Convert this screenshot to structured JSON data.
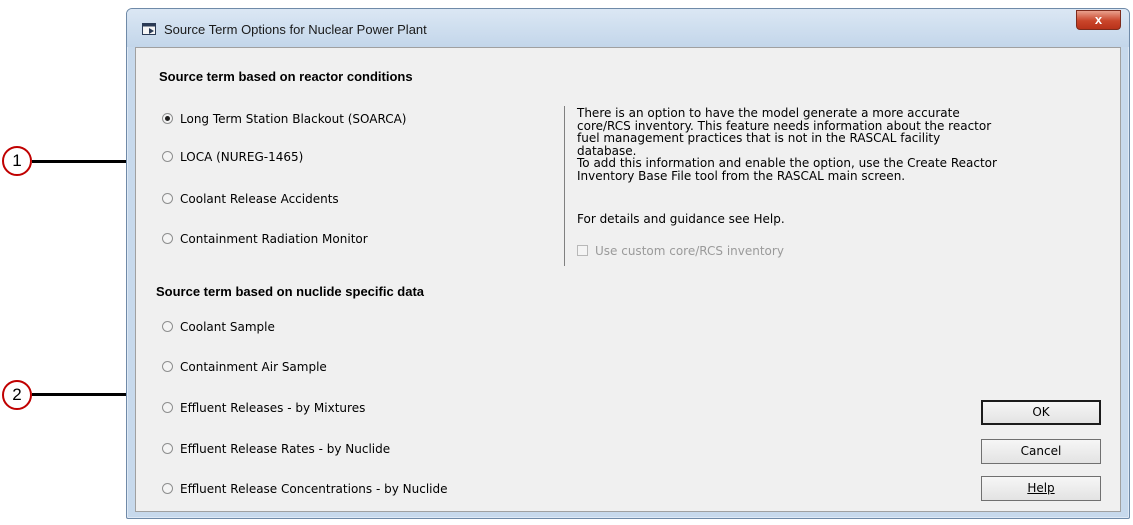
{
  "window": {
    "title": "Source Term Options for Nuclear Power Plant",
    "close_label": "x"
  },
  "annotations": [
    {
      "label": "1"
    },
    {
      "label": "2"
    }
  ],
  "reactor_section": {
    "heading": "Source term based on reactor conditions",
    "options": [
      {
        "label": "Long Term Station Blackout (SOARCA)",
        "checked": true
      },
      {
        "label": "LOCA (NUREG-1465)",
        "checked": false
      },
      {
        "label": "Coolant Release Accidents",
        "checked": false
      },
      {
        "label": "Containment Radiation Monitor",
        "checked": false
      }
    ]
  },
  "info_panel": {
    "lines": [
      "There is an option to have the model generate a more accurate",
      "core/RCS inventory. This feature needs information about the reactor",
      "fuel management practices that is not in the RASCAL facility database.",
      "To add this information and enable the option, use the Create Reactor",
      "Inventory Base File tool from the RASCAL main screen."
    ],
    "help_hint": "For details and guidance see Help.",
    "custom_inventory_label": "Use custom core/RCS inventory",
    "custom_inventory_checked": false,
    "custom_inventory_enabled": false
  },
  "nuclide_section": {
    "heading": "Source term based on nuclide specific data",
    "options": [
      {
        "label": "Coolant Sample",
        "checked": false
      },
      {
        "label": "Containment Air Sample",
        "checked": false
      },
      {
        "label": "Effluent Releases - by Mixtures",
        "checked": false
      },
      {
        "label": "Effluent Release Rates - by Nuclide",
        "checked": false
      },
      {
        "label": "Effluent Release Concentrations - by Nuclide",
        "checked": false
      }
    ]
  },
  "buttons": {
    "ok_label": "OK",
    "cancel_label": "Cancel",
    "help_label": "Help"
  },
  "colors": {
    "callout_circle_border": "#c00000",
    "close_button": "#c9452a",
    "title_bar": "#c7d9ec"
  }
}
